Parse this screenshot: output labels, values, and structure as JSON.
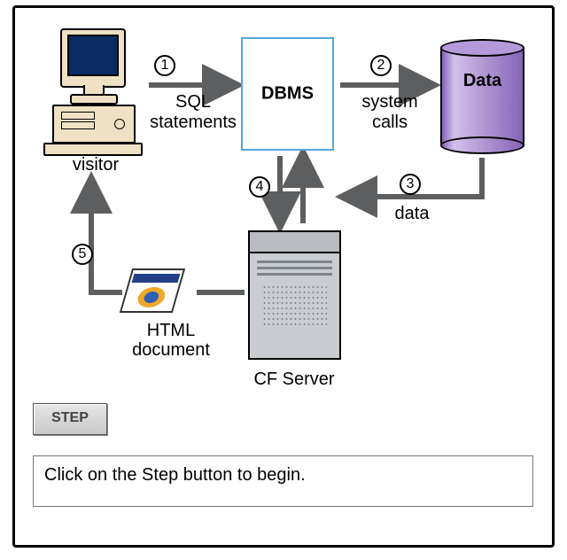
{
  "nodes": {
    "visitor": "visitor",
    "dbms": "DBMS",
    "data": "Data",
    "server": "CF Server",
    "html_doc_line1": "HTML",
    "html_doc_line2": "document"
  },
  "edges": {
    "e1": {
      "num": "1",
      "line1": "SQL",
      "line2": "statements"
    },
    "e2": {
      "num": "2",
      "line1": "system",
      "line2": "calls"
    },
    "e3": {
      "num": "3",
      "label": "data"
    },
    "e4": {
      "num": "4"
    },
    "e5": {
      "num": "5"
    }
  },
  "controls": {
    "step": "STEP",
    "instruction": "Click on the Step button to begin."
  }
}
